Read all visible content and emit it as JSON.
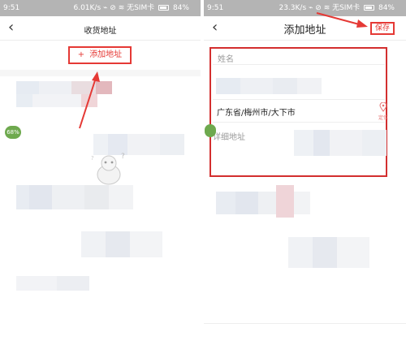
{
  "left_screen": {
    "status": {
      "time": "9:51",
      "network": "6.01K/s ⌁ ⊘ ≋ 无SIM卡",
      "battery": "84%"
    },
    "header": {
      "back_icon": "chevron-left-icon",
      "title": "收货地址"
    },
    "add_address": {
      "plus": "+",
      "label": "添加地址"
    },
    "avatar_badge": "68%"
  },
  "right_screen": {
    "status": {
      "time": "9:51",
      "network": "23.3K/s ⌁ ⊘ ≋ 无SIM卡",
      "battery": "84%"
    },
    "header": {
      "back_icon": "chevron-left-icon",
      "title": "添加地址",
      "save_label": "保存"
    },
    "form": {
      "name_label": "姓名",
      "region_value": "广东省/梅州市/大下市",
      "locate_label": "定位",
      "detail_label": "详细地址"
    }
  },
  "colors": {
    "accent": "#e53935",
    "statusbar": "#b4b4b4",
    "badge": "#6ea94e"
  }
}
